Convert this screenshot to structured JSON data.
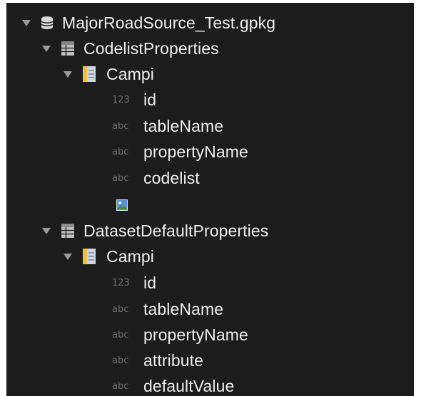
{
  "tree": {
    "root": {
      "label": "MajorRoadSource_Test.gpkg",
      "icon": "database-icon"
    },
    "tables": [
      {
        "label": "CodelistProperties",
        "icon": "table-icon",
        "group": {
          "label": "Campi",
          "icon": "fields-icon",
          "fields": [
            {
              "type": "123",
              "name": "id"
            },
            {
              "type": "abc",
              "name": "tableName"
            },
            {
              "type": "abc",
              "name": "propertyName"
            },
            {
              "type": "abc",
              "name": "codelist"
            }
          ],
          "extra_icon": "image-icon"
        }
      },
      {
        "label": "DatasetDefaultProperties",
        "icon": "table-icon",
        "group": {
          "label": "Campi",
          "icon": "fields-icon",
          "fields": [
            {
              "type": "123",
              "name": "id"
            },
            {
              "type": "abc",
              "name": "tableName"
            },
            {
              "type": "abc",
              "name": "propertyName"
            },
            {
              "type": "abc",
              "name": "attribute"
            },
            {
              "type": "abc",
              "name": "defaultValue"
            }
          ]
        }
      }
    ]
  },
  "colors": {
    "panel_background": "#1c1c1c",
    "text": "#eeeeee",
    "type_tag": "#6f6f6f",
    "chevron": "#9a9a9a",
    "fields_icon_accent": "#e8c24a"
  }
}
